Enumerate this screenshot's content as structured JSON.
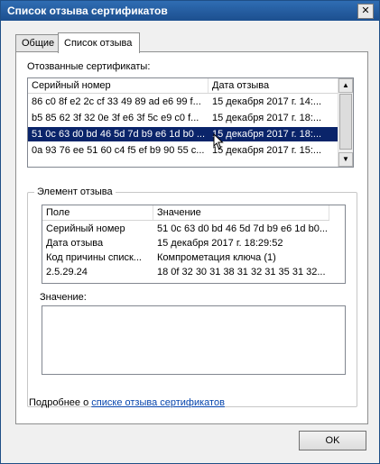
{
  "window": {
    "title": "Список отзыва сертификатов",
    "close_glyph": "✕"
  },
  "tabs": [
    {
      "label": "Общие",
      "active": false
    },
    {
      "label": "Список отзыва",
      "active": true
    }
  ],
  "revoked": {
    "label": "Отозванные сертификаты:",
    "columns": [
      "Серийный номер",
      "Дата отзыва"
    ],
    "rows": [
      {
        "serial": "86 c0 8f e2 2c cf 33 49 89 ad e6 99 f...",
        "date": "15 декабря 2017 г. 14:...",
        "selected": false
      },
      {
        "serial": "b5 85 62 3f 32 0e 3f e6 3f 5c e9 c0 f...",
        "date": "15 декабря 2017 г. 18:...",
        "selected": false
      },
      {
        "serial": "51 0c 63 d0 bd 46 5d 7d b9 e6 1d b0 ...",
        "date": "15 декабря 2017 г. 18:...",
        "selected": true
      },
      {
        "serial": "0a 93 76 ee 51 60 c4 f5 ef b9 90 55 c...",
        "date": "15 декабря 2017 г. 15:...",
        "selected": false
      }
    ]
  },
  "entry": {
    "group_label": "Элемент отзыва",
    "columns": [
      "Поле",
      "Значение"
    ],
    "rows": [
      {
        "field": "Серийный номер",
        "value": "51 0c 63 d0 bd 46 5d 7d b9 e6 1d b0..."
      },
      {
        "field": "Дата отзыва",
        "value": "15 декабря 2017 г. 18:29:52"
      },
      {
        "field": "Код причины списк...",
        "value": "Компрометация ключа (1)"
      },
      {
        "field": "2.5.29.24",
        "value": "18 0f 32 30 31 38 31 32 31 35 31 32..."
      }
    ],
    "value_label": "Значение:"
  },
  "more_info": {
    "prefix": "Подробнее о ",
    "link": "списке отзыва сертификатов"
  },
  "ok_label": "OK",
  "colors": {
    "title_bar": "#2f6db3",
    "selection": "#0a246a",
    "link": "#0645ad"
  }
}
